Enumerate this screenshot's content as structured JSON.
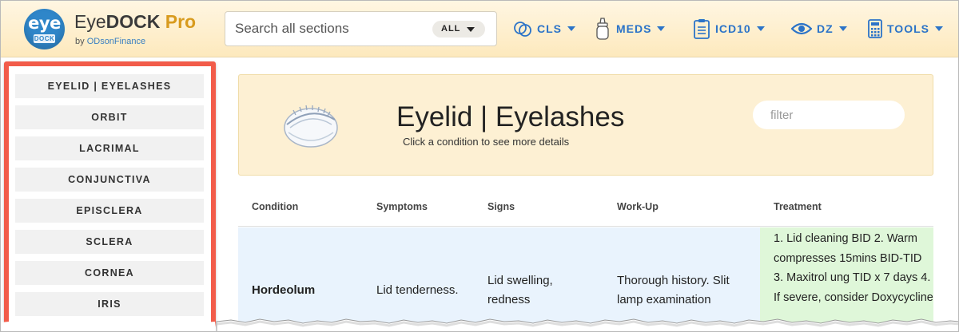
{
  "brand": {
    "logo_top": "eye",
    "logo_bottom": "DOCK",
    "name_prefix": "Eye",
    "name_bold": "DOCK",
    "name_suffix": " Pro",
    "by_prefix": "by ",
    "by_link": "ODsonFinance"
  },
  "search": {
    "placeholder": "Search all sections",
    "value": "",
    "scope": "ALL"
  },
  "nav": [
    {
      "label": "CLS",
      "icon": "contact-lens-icon"
    },
    {
      "label": "MEDS",
      "icon": "dropper-bottle-icon"
    },
    {
      "label": "ICD10",
      "icon": "clipboard-icon"
    },
    {
      "label": "DZ",
      "icon": "eye-icon"
    },
    {
      "label": "TOOLS",
      "icon": "calculator-icon"
    }
  ],
  "sidebar": {
    "items": [
      {
        "label": "EYELID | EYELASHES"
      },
      {
        "label": "ORBIT"
      },
      {
        "label": "LACRIMAL"
      },
      {
        "label": "CONJUNCTIVA"
      },
      {
        "label": "EPISCLERA"
      },
      {
        "label": "SCLERA"
      },
      {
        "label": "CORNEA"
      },
      {
        "label": "IRIS"
      }
    ]
  },
  "section": {
    "title": "Eyelid | Eyelashes",
    "subtitle": "Click a condition to see more details",
    "filter_placeholder": "filter"
  },
  "table": {
    "columns": [
      "Condition",
      "Symptoms",
      "Signs",
      "Work-Up",
      "Treatment"
    ],
    "rows": [
      {
        "condition": "Hordeolum",
        "symptoms": "Lid tenderness.",
        "signs": "Lid swelling, redness",
        "workup": "Thorough history. Slit lamp examination",
        "treatment": "1. Lid cleaning BID 2. Warm compresses 15mins BID-TID 3. Maxitrol ung TID x 7 days 4. If severe, consider Doxycycline"
      }
    ]
  },
  "colors": {
    "accent_blue": "#2b73c8",
    "highlight_red": "#f25c4a",
    "banner_bg": "#fdf0d3",
    "treatment_bg": "#dff7d9"
  }
}
